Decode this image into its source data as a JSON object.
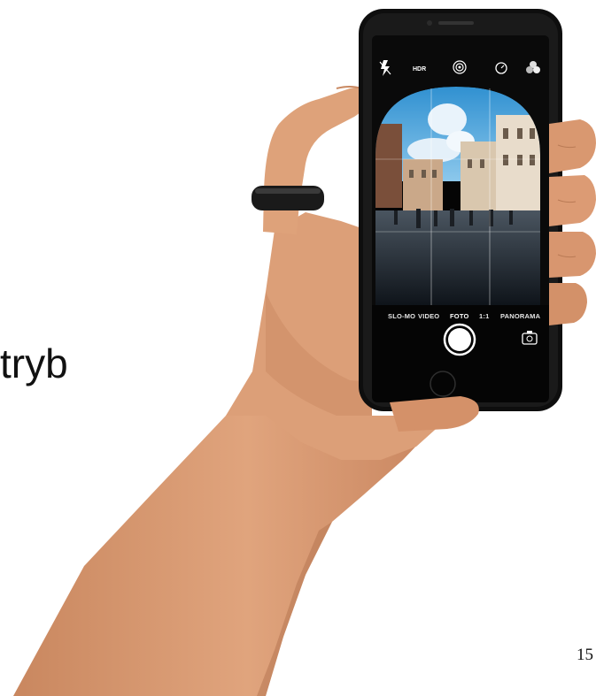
{
  "slide": {
    "word": "tryb",
    "page_number": "15"
  },
  "camera_app": {
    "top_bar": {
      "flash_icon": "flash-off-icon",
      "hdr_label": "HDR",
      "live_icon": "live-photo-icon",
      "timer_icon": "timer-icon",
      "filters_icon": "filters-icon"
    },
    "modes": [
      "SLO-MO",
      "VIDEO",
      "FOTO",
      "1:1",
      "PANORAMA"
    ],
    "selected_mode": "FOTO",
    "shutter_icon": "shutter-button-icon",
    "switch_camera_icon": "switch-camera-icon"
  },
  "colors": {
    "skin": "#d99b74",
    "skin_shadow": "#b97a55",
    "phone_body": "#121212",
    "sky": "#3f9fd6",
    "mode_highlight": "#ffffff"
  }
}
